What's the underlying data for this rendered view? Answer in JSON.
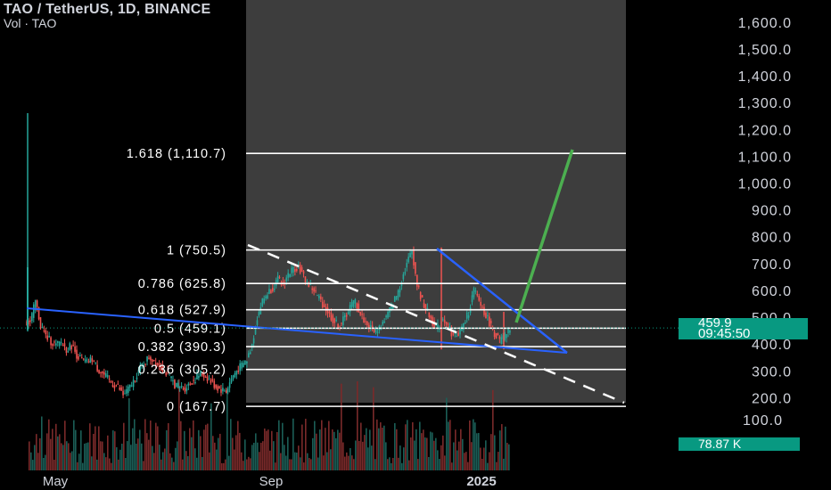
{
  "header": {
    "title": "TAO / TetherUS, 1D, BINANCE",
    "volume_label": "Vol · TAO"
  },
  "price_tag": {
    "price": "459.9",
    "countdown": "09:45:50",
    "color": "#089981"
  },
  "volume_tag": {
    "value": "78.87 K",
    "color": "#089981"
  },
  "chart_data": {
    "type": "candlestick",
    "title": "TAO / TetherUS, 1D, BINANCE",
    "price_axis": {
      "ticks": [
        "1,600.0",
        "1,500.0",
        "1,400.0",
        "1,300.0",
        "1,200.0",
        "1,100.0",
        "1,000.0",
        "900.0",
        "800.0",
        "700.0",
        "600.0",
        "500.0",
        "400.0",
        "300.0",
        "200.0"
      ],
      "tick_values": [
        1600,
        1500,
        1400,
        1300,
        1200,
        1100,
        1000,
        900,
        800,
        700,
        600,
        500,
        400,
        300,
        200
      ],
      "range": [
        130,
        1670
      ]
    },
    "volume_axis": {
      "ticks": [
        "100.0"
      ],
      "tick_values": [
        100
      ]
    },
    "time_axis": {
      "labels": [
        "May",
        "Sep",
        "2025"
      ]
    },
    "fibonacci": [
      {
        "label": "1.618 (1,110.7)",
        "value": 1110.7
      },
      {
        "label": "1 (750.5)",
        "value": 750.5
      },
      {
        "label": "0.786 (625.8)",
        "value": 625.8
      },
      {
        "label": "0.618 (527.9)",
        "value": 527.9
      },
      {
        "label": "0.5 (459.1)",
        "value": 459.1
      },
      {
        "label": "0.382 (390.3)",
        "value": 390.3
      },
      {
        "label": "0.236 (305.2)",
        "value": 305.2
      },
      {
        "label": "0 (167.7)",
        "value": 167.7
      }
    ],
    "current_price": 459.9,
    "colors": {
      "up": "#26a69a",
      "down": "#ef5350",
      "trendline": "#2962ff",
      "projection": "#4caf50",
      "fib": "#ffffff"
    },
    "price_points": [
      480,
      560,
      470,
      430,
      410,
      395,
      405,
      380,
      395,
      360,
      340,
      330,
      345,
      310,
      290,
      270,
      250,
      240,
      210,
      230,
      260,
      300,
      330,
      350,
      340,
      320,
      300,
      280,
      250,
      240,
      235,
      255,
      270,
      290,
      280,
      260,
      240,
      230,
      225,
      270,
      300,
      320,
      340,
      400,
      500,
      560,
      590,
      610,
      640,
      620,
      660,
      680,
      690,
      650,
      620,
      600,
      570,
      540,
      510,
      480,
      470,
      500,
      540,
      560,
      510,
      480,
      460,
      450,
      470,
      500,
      540,
      580,
      640,
      700,
      750,
      620,
      560,
      520,
      480,
      460,
      500,
      470,
      430,
      440,
      470,
      520,
      600,
      560,
      520,
      480,
      440,
      410,
      430,
      460
    ]
  }
}
